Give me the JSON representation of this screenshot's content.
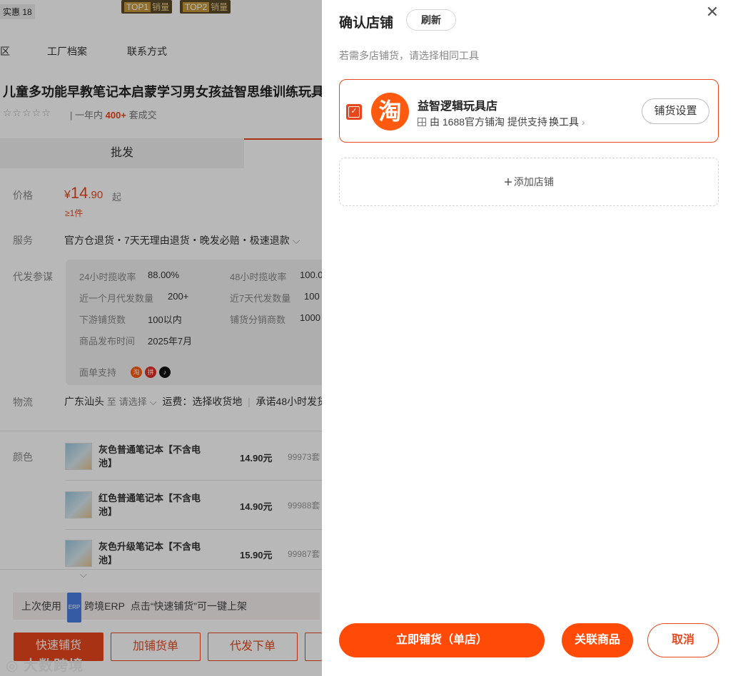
{
  "background": {
    "top_hint": "实惠 18",
    "badges": [
      {
        "rank": "TOP1",
        "label": "销量"
      },
      {
        "rank": "TOP2",
        "label": "销量"
      }
    ],
    "nav_tabs": [
      "区",
      "工厂档案",
      "联系方式"
    ],
    "product_title": "儿童多功能早教笔记本启蒙学习男女孩益智思维训练玩具",
    "stars": "☆☆☆☆☆",
    "year_prefix": "一年内",
    "year_count": "400+",
    "year_suffix": "套成交",
    "tab_wholesale": "批发",
    "price": {
      "label": "价格",
      "currency": "¥",
      "integer": "14",
      "decimal": ".90",
      "unit": "起",
      "min_qty": "≥1件"
    },
    "service": {
      "label": "服务",
      "text": "官方仓退货・7天无理由退货・晚发必赔・极速退款",
      "chevron": "⌵"
    },
    "dropship": {
      "label": "代发参谋",
      "stats": [
        {
          "label": "24小时揽收率",
          "value": "88.00%"
        },
        {
          "label": "48小时揽收率",
          "value": "100.0"
        },
        {
          "label": "近一个月代发数量",
          "value": "200+"
        },
        {
          "label": "近7天代发数量",
          "value": "100"
        },
        {
          "label": "下游铺货数",
          "value": "100以内"
        },
        {
          "label": "铺货分销商数",
          "value": "1000"
        },
        {
          "label": "商品发布时间",
          "value": "2025年7月"
        }
      ],
      "order_support_label": "面单支持",
      "platform_icons": [
        "taobao-icon",
        "pinduoduo-icon",
        "douyin-icon"
      ]
    },
    "logistics": {
      "label": "物流",
      "origin": "广东汕头",
      "to": "至",
      "select": "请选择",
      "shipping": "运费：选择收货地",
      "promise": "承诺48小时发货"
    },
    "color_label": "颜色",
    "skus": [
      {
        "name": "灰色普通笔记本【不含电池】",
        "price": "14.90元",
        "stock": "99973套"
      },
      {
        "name": "红色普通笔记本【不含电池】",
        "price": "14.90元",
        "stock": "99988套"
      },
      {
        "name": "灰色升级笔记本【不含电池】",
        "price": "15.90元",
        "stock": "99987套"
      }
    ],
    "erp_bar": {
      "prefix": "上次使用",
      "chip": "ERP",
      "tool": "跨境ERP",
      "suffix": "点击“快速铺货”可一键上架"
    },
    "actions": [
      "快速铺货",
      "加铺货单",
      "代发下单"
    ],
    "watermark": "大数跨境"
  },
  "drawer": {
    "title": "确认店铺",
    "refresh": "刷新",
    "close_glyph": "✕",
    "hint": "若需多店铺货，请选择相同工具",
    "store": {
      "checked": true,
      "logo_char": "淘",
      "name": "益智逻辑玩具店",
      "support_text": "由 1688官方铺淘 提供支持",
      "switch_tool": "换工具",
      "setting_button": "铺货设置"
    },
    "add_store": {
      "plus": "+",
      "label": "添加店铺"
    },
    "buttons": {
      "publish": "立即铺货（单店）",
      "link_products": "关联商品",
      "cancel": "取消"
    },
    "accent_color": "#FF4A08"
  }
}
